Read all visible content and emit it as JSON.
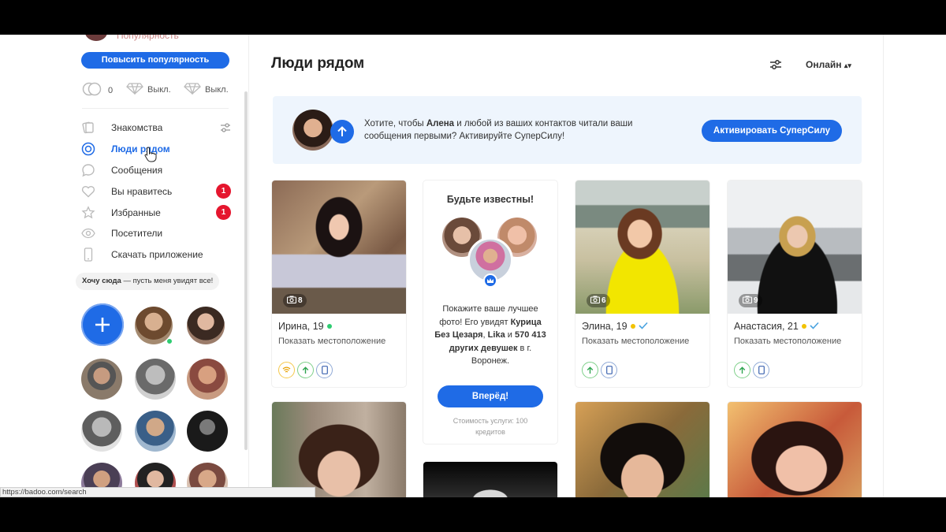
{
  "status_bar": {
    "url": "https://badoo.com/search"
  },
  "sidebar": {
    "top_text": "Популярность",
    "boost_label": "Повысить популярность",
    "credits": {
      "count": "0",
      "super1": "Выкл.",
      "super2": "Выкл."
    },
    "nav": [
      {
        "label": "Знакомства"
      },
      {
        "label": "Люди рядом"
      },
      {
        "label": "Сообщения"
      },
      {
        "label": "Вы нравитесь",
        "badge": "1"
      },
      {
        "label": "Избранные",
        "badge": "1"
      },
      {
        "label": "Посетители"
      },
      {
        "label": "Скачать приложение"
      }
    ],
    "want_here_bold": "Хочу сюда",
    "want_here_rest": " — пусть меня увидят все!"
  },
  "main": {
    "title": "Люди рядом",
    "online_filter": "Онлайн",
    "promo": {
      "text_prefix": "Хотите, чтобы ",
      "text_name": "Алена",
      "text_suffix": " и любой из ваших контактов читали ваши сообщения первыми? Активируйте СуперСилу!",
      "button": "Активировать СуперСилу"
    },
    "famous": {
      "title": "Будьте известны!",
      "text_1": "Покажите ваше лучшее фото! Его увидят ",
      "bold_1": "Курица Без Цезаря",
      "text_2": ", ",
      "bold_2": "Lika",
      "text_3": " и ",
      "bold_3": "570 413 других девушек",
      "text_4": " в г. Воронеж.",
      "button": "Вперёд!",
      "cost": "Стоимость услуги: 100 кредитов"
    },
    "cards": [
      {
        "name": "Ирина, 19",
        "location": "Показать местоположение",
        "photos": "8"
      },
      {
        "name": "Элина, 19",
        "location": "Показать местоположение",
        "photos": "6"
      },
      {
        "name": "Анастасия, 21",
        "location": "Показать местоположение",
        "photos": "9"
      }
    ]
  },
  "colors": {
    "accent": "#1f6be6",
    "badge": "#e5162e",
    "online": "#2ecc71"
  }
}
